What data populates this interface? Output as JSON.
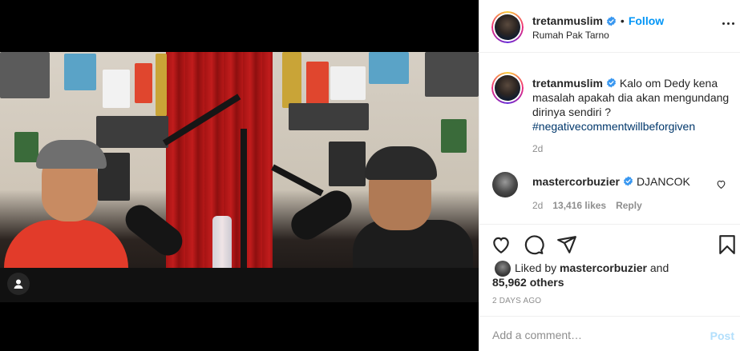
{
  "post": {
    "author": "tretanmuslim",
    "follow_label": "Follow",
    "separator": "•",
    "location": "Rumah Pak Tarno",
    "caption_text": "Kalo om Dedy kena masalah apakah dia akan mengundang dirinya sendiri ?",
    "hashtag": "#negativecommentwillbeforgiven",
    "caption_age": "2d"
  },
  "comment": {
    "author": "mastercorbuzier",
    "text": "DJANCOK",
    "age": "2d",
    "likes": "13,416 likes",
    "reply_label": "Reply"
  },
  "likes": {
    "prefix": "Liked by",
    "user": "mastercorbuzier",
    "suffix": "and",
    "others": "85,962 others"
  },
  "timestamp": "2 DAYS AGO",
  "compose": {
    "placeholder": "Add a comment…",
    "post_label": "Post"
  },
  "icons": {
    "verified": "verified-badge-icon",
    "more": "more-options-icon",
    "like": "heart-icon",
    "comment": "comment-bubble-icon",
    "share": "paper-plane-icon",
    "save": "bookmark-icon",
    "tag": "user-tag-icon"
  },
  "colors": {
    "accent": "#0095f6",
    "hashtag": "#00376b",
    "muted": "#8e8e8e",
    "post_disabled": "#b2dffc"
  }
}
